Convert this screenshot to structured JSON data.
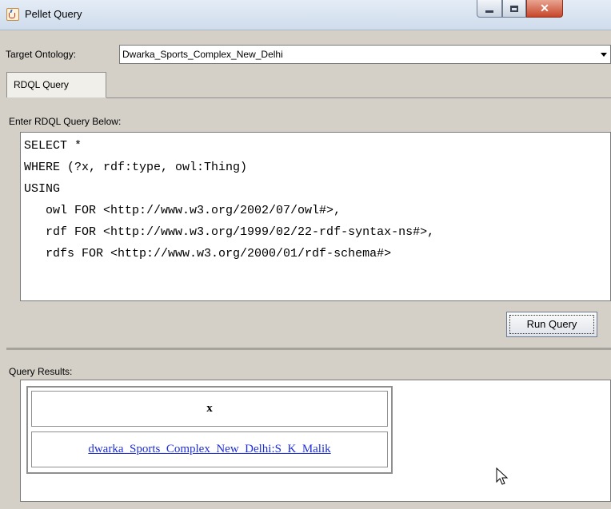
{
  "window": {
    "title": "Pellet Query"
  },
  "target": {
    "label": "Target Ontology:",
    "value": "Dwarka_Sports_Complex_New_Delhi"
  },
  "tabs": [
    {
      "label": "RDQL Query"
    }
  ],
  "query": {
    "label": "Enter RDQL Query Below:",
    "lines": [
      "SELECT *",
      "WHERE (?x, rdf:type, owl:Thing)",
      "USING",
      "   owl FOR <http://www.w3.org/2002/07/owl#>,",
      "   rdf FOR <http://www.w3.org/1999/02/22-rdf-syntax-ns#>,",
      "   rdfs FOR <http://www.w3.org/2000/01/rdf-schema#>"
    ],
    "run_label": "Run Query"
  },
  "results": {
    "label": "Query Results:",
    "columns": [
      "x"
    ],
    "rows": [
      [
        "dwarka_Sports_Complex_New_Delhi:S_K_Malik"
      ]
    ]
  },
  "icons": {
    "app": "java-app-icon",
    "cursor": "mouse-pointer-icon"
  }
}
